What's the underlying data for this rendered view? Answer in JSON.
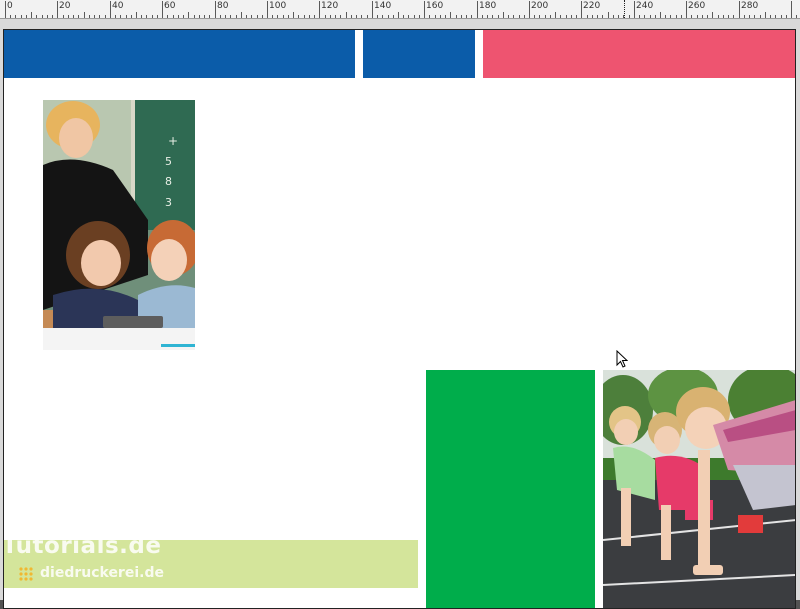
{
  "ruler": {
    "labels": [
      "0",
      "20",
      "40",
      "60",
      "80",
      "100",
      "120",
      "140",
      "160",
      "180",
      "200",
      "220",
      "240",
      "260",
      "280"
    ]
  },
  "colors": {
    "blue": "#0b5ca9",
    "pink": "#ee5470",
    "green": "#00ad4b",
    "light_green": "#d4e59b",
    "page": "#ffffff",
    "pasteboard": "#d9d9d9",
    "ruler_bg": "#f2f2f2"
  },
  "frames": [
    {
      "name": "blue-bar-left-frame",
      "color": "blue"
    },
    {
      "name": "blue-bar-middle-frame",
      "color": "blue"
    },
    {
      "name": "pink-bar-frame",
      "color": "pink"
    },
    {
      "name": "green-block-frame",
      "color": "green"
    },
    {
      "name": "light-green-bar-frame",
      "color": "light_green"
    }
  ],
  "images": [
    {
      "name": "classroom-photo",
      "subject": "teacher with two children using a tablet in front of a chalkboard"
    },
    {
      "name": "kids-running-photo",
      "subject": "three girls in sprint start position on a running track"
    }
  ],
  "watermark": {
    "line1": "Tutorials.de",
    "line2": "diedruckerei.de"
  },
  "cursor": {
    "icon": "arrow-cursor-icon"
  }
}
